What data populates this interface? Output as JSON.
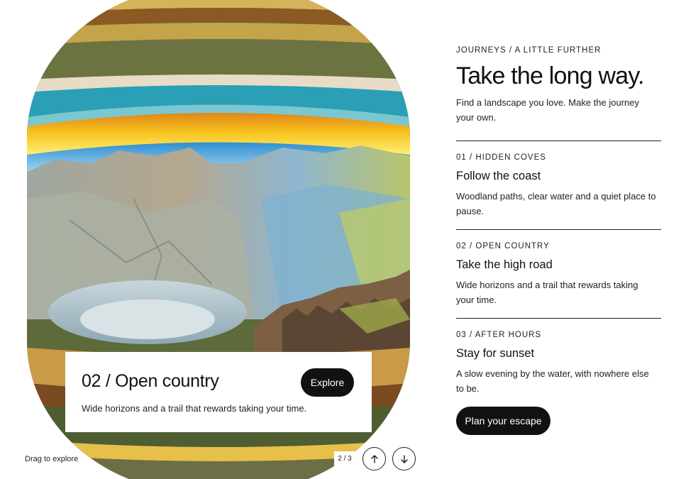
{
  "gallery": {
    "image_alt": "Mountain crater landscape photo distorted into a barrel shape",
    "caption": {
      "title": "02 / Open country",
      "description": "Wide horizons and a trail that rewards taking your time.",
      "explore_label": "Explore"
    },
    "drag_hint": "Drag to explore",
    "counter": "2 / 3",
    "prev_icon": "arrow-up-icon",
    "next_icon": "arrow-down-icon"
  },
  "panel": {
    "eyebrow": "JOURNEYS / A LITTLE FURTHER",
    "headline": "Take the long way.",
    "intro": "Find a landscape you love. Make the journey your own.",
    "items": [
      {
        "eyebrow": "01 / HIDDEN COVES",
        "title": "Follow the coast",
        "description": "Woodland paths, clear water and a quiet place to pause."
      },
      {
        "eyebrow": "02 / OPEN COUNTRY",
        "title": "Take the high road",
        "description": "Wide horizons and a trail that rewards taking your time."
      },
      {
        "eyebrow": "03 / AFTER HOURS",
        "title": "Stay for sunset",
        "description": "A slow evening by the water, with nowhere else to be."
      }
    ],
    "cta_label": "Plan your escape"
  },
  "colors": {
    "ink": "#111111",
    "background": "#ffffff",
    "sky": "#5fb6e0",
    "sunset": "#f7c21d",
    "water": "#2a9fb6",
    "grass": "#5d6a3a"
  }
}
